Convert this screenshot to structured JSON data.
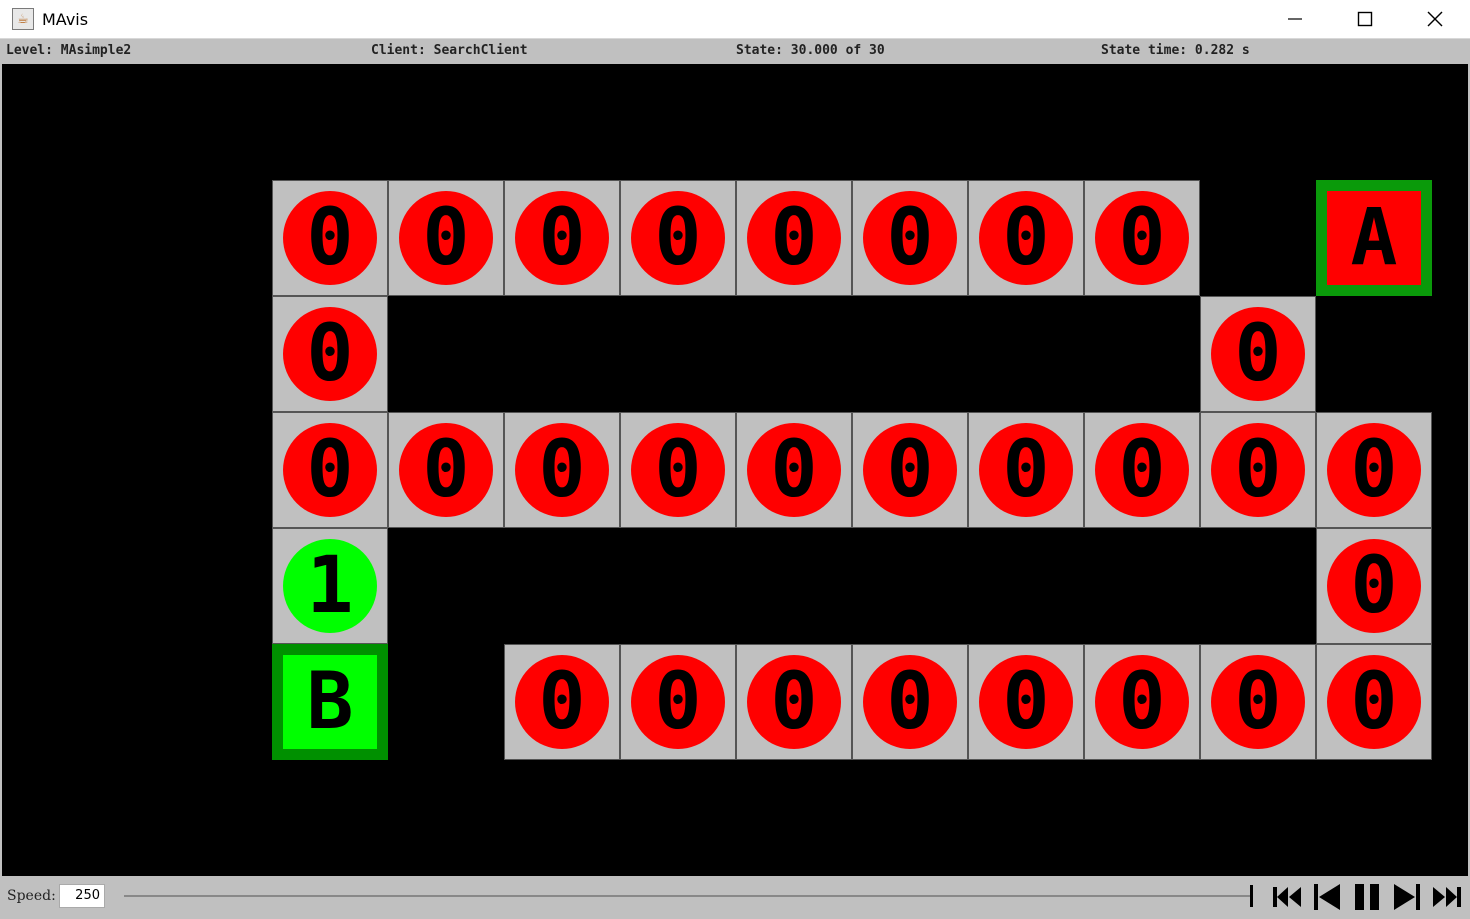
{
  "window": {
    "title": "MAvis",
    "icon": "java-coffee-icon",
    "controls": [
      "minimize-icon",
      "maximize-icon",
      "close-icon"
    ]
  },
  "status": {
    "level": "Level: MAsimple2",
    "client": "Client: SearchClient",
    "state": "State: 30.000 of 30",
    "state_time": "State time: 0.282 s"
  },
  "level": {
    "colors": {
      "floor": "#c0c0c0",
      "wall": "#000000",
      "red": "#ff0000",
      "red_border": "#0a9a0a",
      "green": "#00ff00",
      "green_border": "#009000"
    },
    "rows": [
      "++++++++++++",
      "+ 00000000+A",
      "+ 0+++++++0",
      "+ 0000000000",
      "+ 1++++++++0",
      "+ B+00000000",
      "++++++++++++"
    ],
    "boxes": [
      {
        "letter": "A",
        "color": "red",
        "border": "green"
      },
      {
        "letter": "B",
        "color": "green",
        "border": "green"
      }
    ],
    "agents": [
      {
        "id": "0",
        "color": "red"
      },
      {
        "id": "1",
        "color": "green"
      }
    ]
  },
  "controls": {
    "speed_label": "Speed:",
    "speed_value": "250",
    "buttons": [
      "skip-to-start-icon",
      "step-back-icon",
      "pause-icon",
      "step-forward-icon",
      "skip-to-end-icon"
    ]
  }
}
